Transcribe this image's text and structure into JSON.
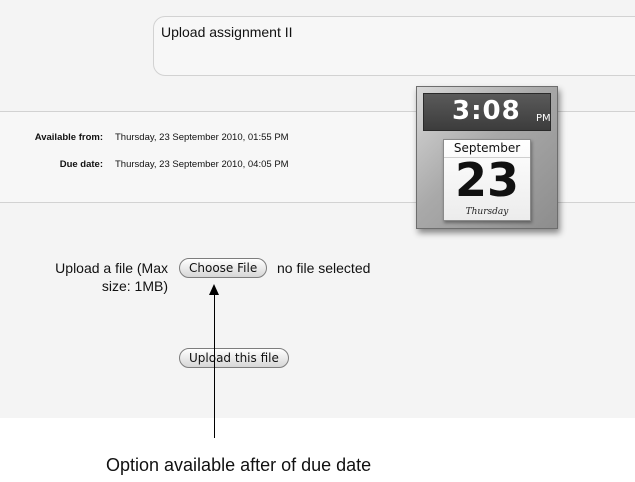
{
  "assignment": {
    "description": "Upload assignment II",
    "available_from_label": "Available from:",
    "available_from_value": "Thursday, 23 September 2010, 01:55 PM",
    "due_date_label": "Due date:",
    "due_date_value": "Thursday, 23 September 2010, 04:05 PM"
  },
  "clock_widget": {
    "time": "3:08",
    "ampm": "PM",
    "month": "September",
    "day": "23",
    "weekday": "Thursday"
  },
  "upload": {
    "label": "Upload a file (Max size: 1MB)",
    "choose_file_label": "Choose File",
    "no_file_text": "no file selected",
    "upload_button_label": "Upload this file"
  },
  "annotation": {
    "caption": "Option available after of due date"
  }
}
